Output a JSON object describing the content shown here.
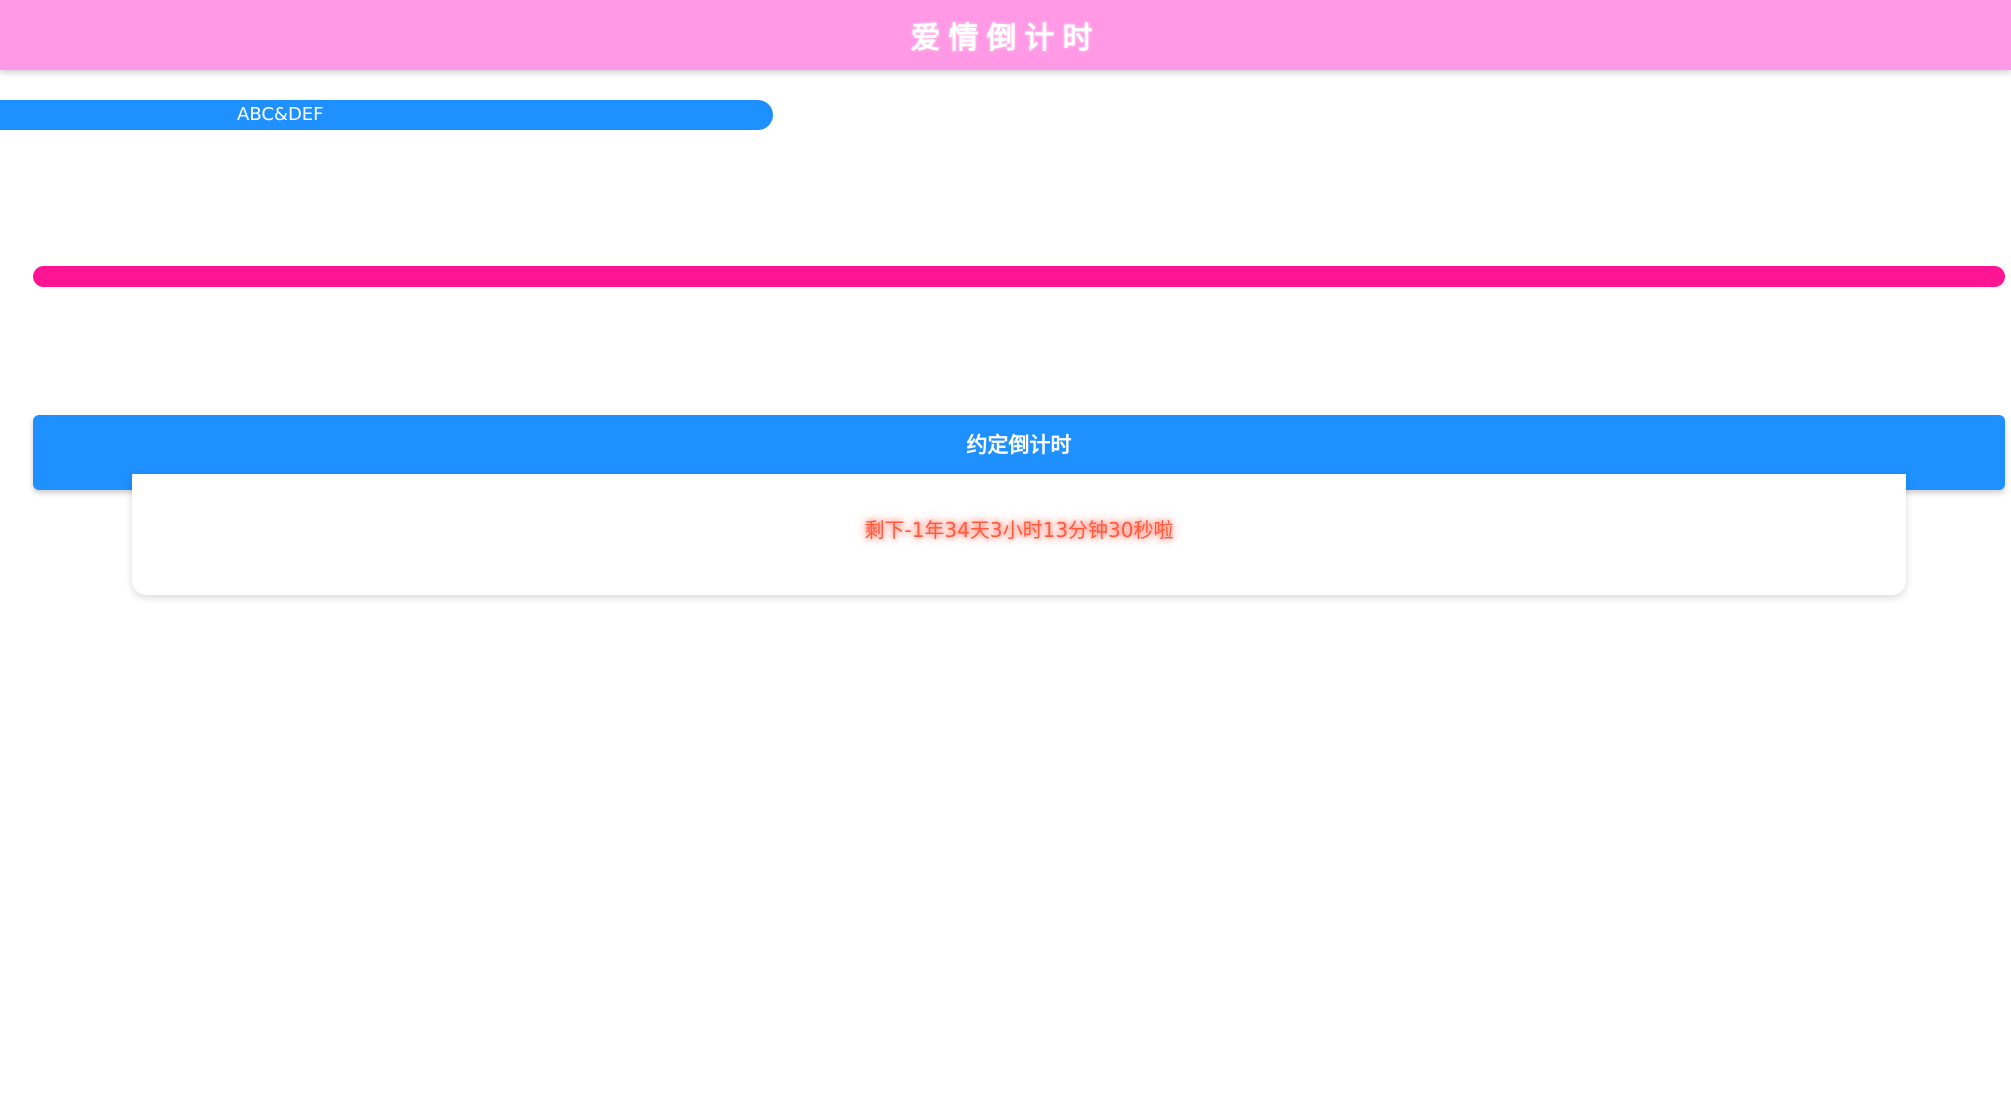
{
  "header": {
    "title": "爱情倒计时",
    "bg_color": "#ff99e6"
  },
  "names": {
    "label": "ABC&DEF",
    "color": "#1e90ff"
  },
  "love_bar": {
    "color": "#ff1493"
  },
  "countdown": {
    "title": "约定倒计时",
    "text": "剩下-1年34天3小时13分钟30秒啦",
    "panel_color": "#1e90ff",
    "text_color": "#ff5a3c"
  }
}
